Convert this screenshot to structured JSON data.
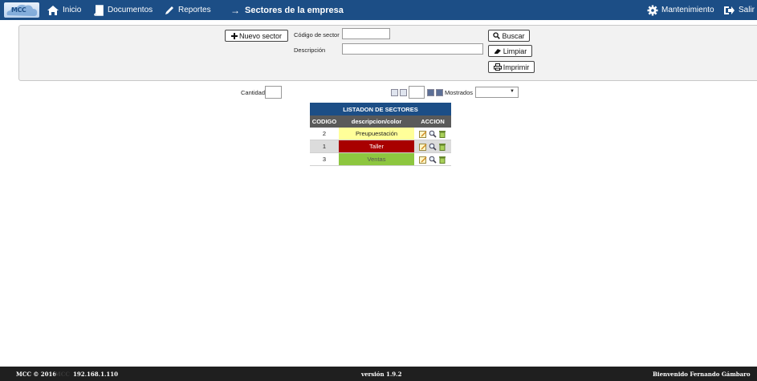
{
  "nav": {
    "logo_text": "MCC",
    "inicio": "Inicio",
    "documentos": "Documentos",
    "reportes": "Reportes",
    "arrow": "→",
    "page_title": "Sectores de la empresa",
    "mantenimiento": "Mantenimiento",
    "salir": "Salir"
  },
  "search": {
    "nuevo_sector": "Nuevo sector",
    "codigo_label": "Código de sector",
    "codigo_value": "",
    "descripcion_label": "Descripción",
    "descripcion_value": "",
    "buscar": "Buscar",
    "limpiar": "Limpiar",
    "imprimir": "Imprimir"
  },
  "pager": {
    "cantidad_label": "Cantidad",
    "cantidad_value": "",
    "page_value": "",
    "mostrados_label": "Mostrados",
    "mostrados_value": ""
  },
  "table": {
    "caption": "LISTADON DE SECTORES",
    "headers": [
      "CODIGO",
      "descripcion/color",
      "ACCION"
    ],
    "rows": [
      {
        "codigo": "2",
        "descripcion": "Preupuestación",
        "bg": "#ffff99",
        "fg": "#222222",
        "row_bg": "#ffffff"
      },
      {
        "codigo": "1",
        "descripcion": "Taller",
        "bg": "#a80000",
        "fg": "#ffffff",
        "row_bg": "#dcdcdc"
      },
      {
        "codigo": "3",
        "descripcion": "Ventas",
        "bg": "#8dc63f",
        "fg": "#555555",
        "row_bg": "#ffffff"
      }
    ],
    "action_icons": [
      "edit-icon",
      "search-icon",
      "delete-icon"
    ]
  },
  "footer": {
    "copyright": "MCC © 2016",
    "brand": "MCC",
    "ip": "192.168.1.110",
    "version": "versión 1.9.2",
    "welcome": "Bienvenido Fernando Gámbaro"
  },
  "colors": {
    "nav_bg": "#1c4e86",
    "footer_bg": "#1f1f1f",
    "table_header": "#5a5a5a"
  }
}
